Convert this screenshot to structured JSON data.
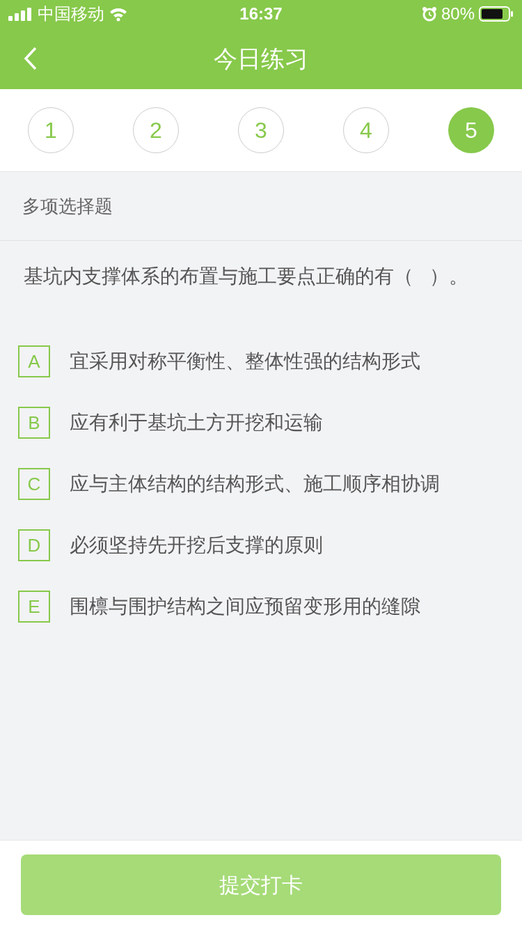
{
  "status_bar": {
    "carrier": "中国移动",
    "time": "16:37",
    "battery": "80%"
  },
  "nav": {
    "title": "今日练习"
  },
  "question_numbers": [
    {
      "label": "1",
      "selected": false
    },
    {
      "label": "2",
      "selected": false
    },
    {
      "label": "3",
      "selected": false
    },
    {
      "label": "4",
      "selected": false
    },
    {
      "label": "5",
      "selected": true
    }
  ],
  "question_type": "多项选择题",
  "question": "基坑内支撑体系的布置与施工要点正确的有（   ）。",
  "options": [
    {
      "letter": "A",
      "text": "宜采用对称平衡性、整体性强的结构形式",
      "selected": false
    },
    {
      "letter": "B",
      "text": "应有利于基坑土方开挖和运输",
      "selected": false
    },
    {
      "letter": "C",
      "text": "应与主体结构的结构形式、施工顺序相协调",
      "selected": false
    },
    {
      "letter": "D",
      "text": "必须坚持先开挖后支撑的原则",
      "selected": false
    },
    {
      "letter": "E",
      "text": "围檩与围护结构之间应预留变形用的缝隙",
      "selected": false
    }
  ],
  "submit_button": {
    "label": "提交打卡",
    "disabled": true
  }
}
